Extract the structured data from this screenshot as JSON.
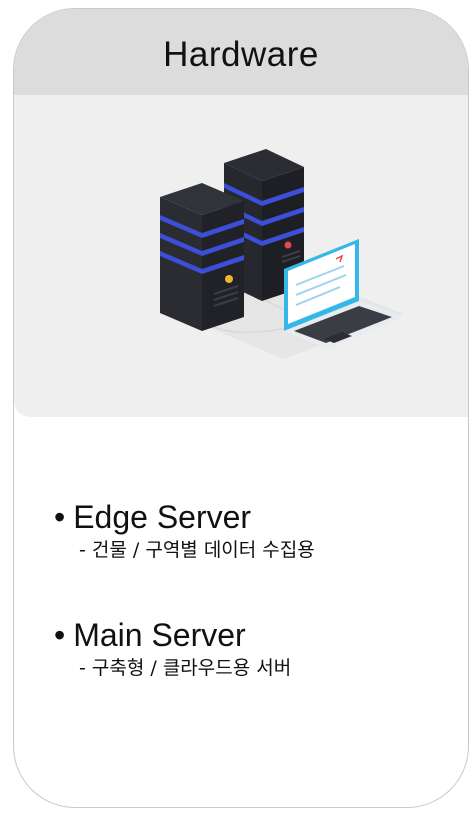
{
  "card": {
    "title": "Hardware"
  },
  "illustration": {
    "icon": "server-rack-with-laptop",
    "colors": {
      "server_body": "#2b2d33",
      "server_accent": "#3b4fd8",
      "laptop_screen": "#35b7e8",
      "code_accent": "#e24a4a"
    }
  },
  "items": [
    {
      "bullet": "•",
      "title": "Edge Server",
      "detail": "- 건물 / 구역별 데이터 수집용"
    },
    {
      "bullet": "•",
      "title": "Main Server",
      "detail": "- 구축형 / 클라우드용 서버"
    }
  ]
}
